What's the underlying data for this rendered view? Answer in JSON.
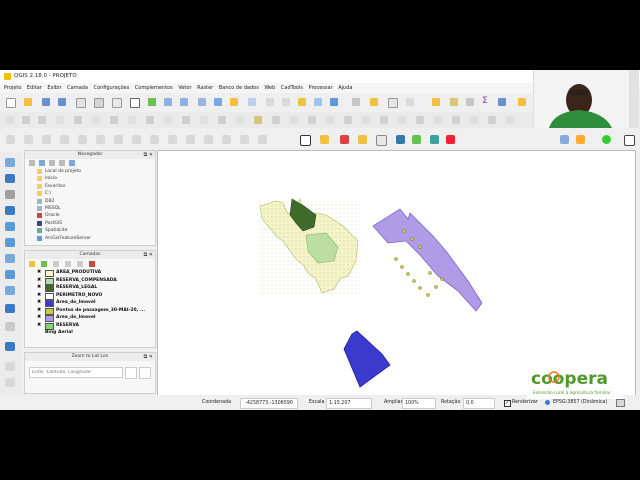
{
  "window": {
    "title": "QGIS 2.18.0 - PROJETO"
  },
  "menu": [
    "Projeto",
    "Editar",
    "Exibir",
    "Camada",
    "Configurações",
    "Complementos",
    "Vetor",
    "Raster",
    "Banco de dados",
    "Web",
    "CadTools",
    "Processar",
    "Ajuda"
  ],
  "navigator": {
    "title": "Navegador",
    "items": [
      "Local do projeto",
      "Início",
      "Favoritos",
      "C:\\",
      "DB2",
      "MSSQL",
      "Oracle",
      "PostGIS",
      "SpatiaLite",
      "ArcGisFeatureServer"
    ]
  },
  "layers": {
    "title": "Camadas",
    "items": [
      {
        "name": "AREA_PRODUTIVA",
        "checked": "✖",
        "color": "#f4f4c8"
      },
      {
        "name": "RESERVA_COMPENSADA",
        "checked": "✖",
        "color": "#b7dca0"
      },
      {
        "name": "RESERVA_LEGAL",
        "checked": "✖",
        "color": "#3f6b2a"
      },
      {
        "name": "PERIMETRO_NOVO",
        "checked": "✖",
        "color": "#ffffff"
      },
      {
        "name": "Area_do_Imovel",
        "checked": "✖",
        "color": "#3a3acd"
      },
      {
        "name": "Pontos de passagem_30-MAI-20, ...",
        "checked": "✖",
        "color": "#c8c850"
      },
      {
        "name": "Area_do_Imovel",
        "checked": "✖",
        "color": "#b09be6"
      },
      {
        "name": "RESERVA",
        "checked": "✖",
        "color": "#7fdc6b"
      },
      {
        "name": "Bing Aerial",
        "checked": "",
        "color": ""
      }
    ]
  },
  "zoom_panel": {
    "title": "Zoom to Lat Lon",
    "input_placeholder": "Enter 'Latitude, Longitude'"
  },
  "status": {
    "coord_label": "Coordenada",
    "coord_value": "-4258773,-1306590",
    "scale_label": "Escala",
    "scale_value": "1:15.207",
    "magnifier_label": "Ampliar",
    "magnifier_value": "100%",
    "rotation_label": "Rotação",
    "rotation_value": "0,0",
    "render_label": "Renderizar",
    "crs_label": "EPSG:3857 (Dinâmica)"
  },
  "logo": {
    "brand": "coopera",
    "tagline": "Extensão rural à agricultura familiar"
  },
  "colors": {
    "accent": "#f2c200",
    "green": "#4d9a2a",
    "orange": "#f07820"
  }
}
